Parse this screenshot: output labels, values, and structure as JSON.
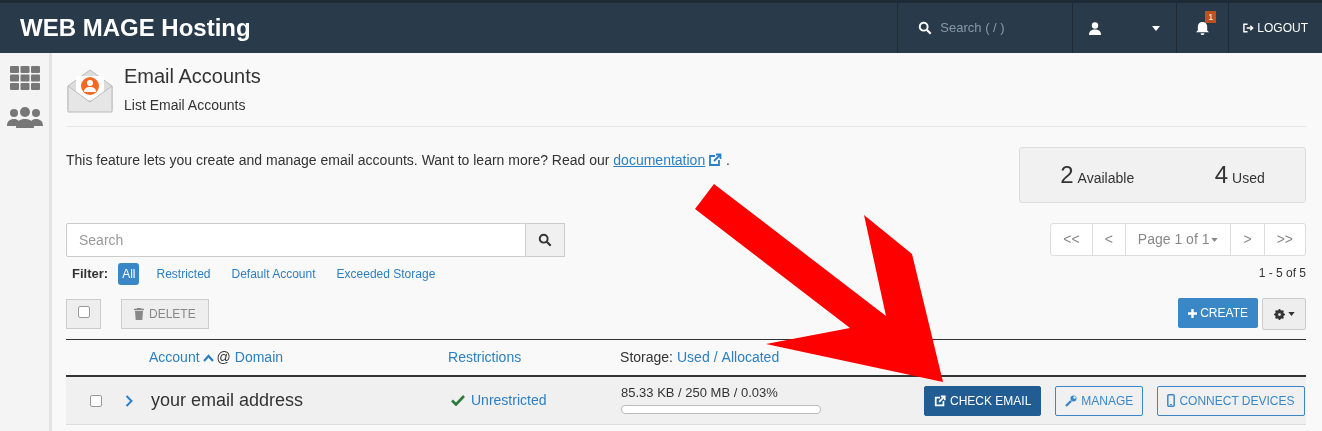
{
  "topbar": {
    "brand": "WEB MAGE Hosting",
    "search_placeholder": "Search ( / )",
    "notification_count": "1",
    "logout": "LOGOUT"
  },
  "page": {
    "title": "Email Accounts",
    "subtitle": "List Email Accounts"
  },
  "intro": {
    "text": "This feature lets you create and manage email accounts. Want to learn more? Read our ",
    "link": "documentation",
    "after": "."
  },
  "stats": [
    {
      "value": "2",
      "label": "Available"
    },
    {
      "value": "4",
      "label": "Used"
    }
  ],
  "search": {
    "placeholder": "Search"
  },
  "pagination": {
    "first": "<<",
    "prev": "<",
    "page": "Page 1 of 1",
    "next": ">",
    "last": ">>",
    "range": "1 - 5 of 5"
  },
  "filter": {
    "label": "Filter:",
    "options": [
      {
        "label": "All",
        "selected": true
      },
      {
        "label": "Restricted",
        "selected": false
      },
      {
        "label": "Default Account",
        "selected": false
      },
      {
        "label": "Exceeded Storage",
        "selected": false
      }
    ]
  },
  "toolbar": {
    "select_all_checked": false,
    "delete": "DELETE",
    "create": "CREATE"
  },
  "table": {
    "columns": {
      "account": "Account",
      "at": "@",
      "domain": "Domain",
      "restrictions": "Restrictions",
      "storage": "Storage:",
      "used": "Used",
      "sep": "/",
      "allocated": "Allocated"
    },
    "rows": [
      {
        "checked": false,
        "account": "your email address",
        "restriction": "Unrestricted",
        "storage": "85.33 KB / 250 MB / 0.03%",
        "level": 0.0003,
        "actions": [
          "CHECK EMAIL",
          "MANAGE",
          "CONNECT DEVICES"
        ]
      }
    ]
  }
}
